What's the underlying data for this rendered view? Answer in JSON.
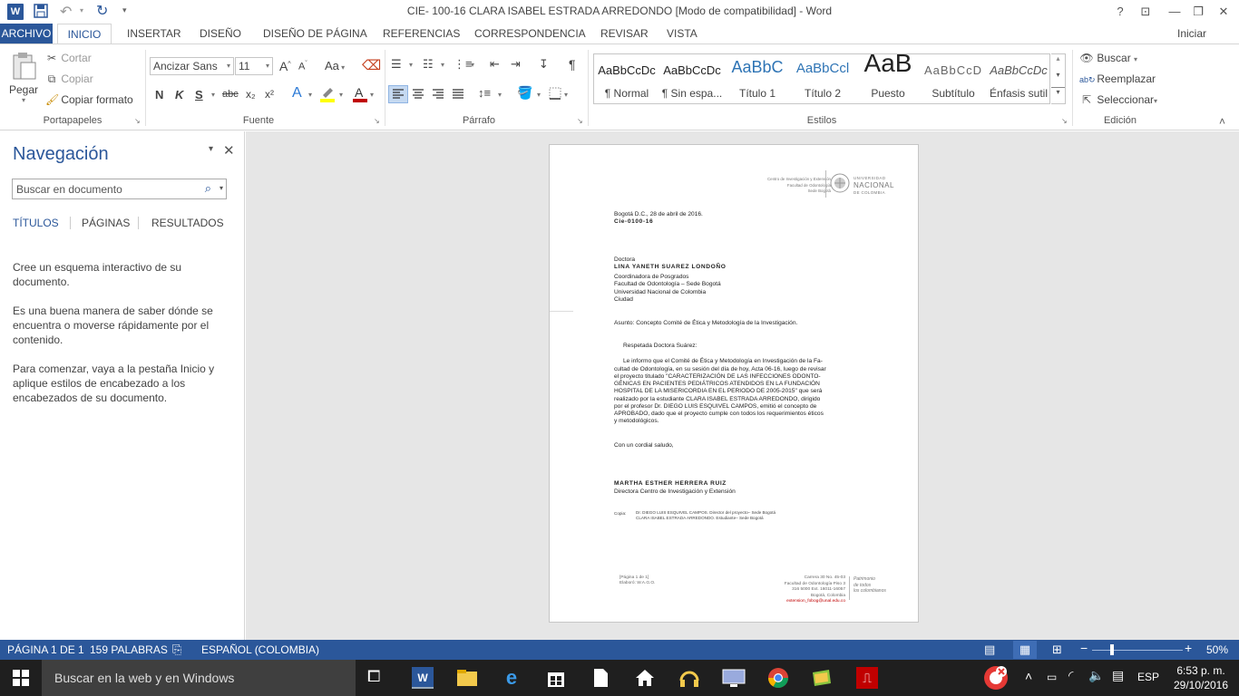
{
  "window": {
    "title": "CIE- 100-16 CLARA ISABEL ESTRADA ARREDONDO [Modo de compatibilidad] - Word",
    "app_icon": "W",
    "help": "?",
    "signin": "Iniciar sesión"
  },
  "tabs": [
    "ARCHIVO",
    "INICIO",
    "INSERTAR",
    "DISEÑO",
    "DISEÑO DE PÁGINA",
    "REFERENCIAS",
    "CORRESPONDENCIA",
    "REVISAR",
    "VISTA"
  ],
  "ribbon": {
    "clipboard": {
      "paste": "Pegar",
      "cut": "Cortar",
      "copy": "Copiar",
      "format_painter": "Copiar formato",
      "label": "Portapapeles"
    },
    "font": {
      "name": "Ancizar Sans",
      "size": "11",
      "label": "Fuente",
      "bold": "N",
      "italic": "K",
      "underline": "S",
      "strike": "abc",
      "sub": "x₂",
      "sup": "x²",
      "aa": "Aa",
      "grow": "A",
      "shrink": "A"
    },
    "paragraph": {
      "label": "Párrafo",
      "pilcrow": "¶"
    },
    "styles": {
      "label": "Estilos",
      "items": [
        {
          "preview": "AaBbCcDc",
          "name": "¶ Normal"
        },
        {
          "preview": "AaBbCcDc",
          "name": "¶ Sin espa..."
        },
        {
          "preview": "AaBbC",
          "name": "Título 1"
        },
        {
          "preview": "AaBbCcl",
          "name": "Título 2"
        },
        {
          "preview": "AaB",
          "name": "Puesto"
        },
        {
          "preview": "AaBbCcD",
          "name": "Subtítulo"
        },
        {
          "preview": "AaBbCcDc",
          "name": "Énfasis sutil"
        }
      ]
    },
    "editing": {
      "find": "Buscar",
      "replace": "Reemplazar",
      "select": "Seleccionar",
      "label": "Edición"
    }
  },
  "nav": {
    "title": "Navegación",
    "search_placeholder": "Buscar en documento",
    "tabs": [
      "TÍTULOS",
      "PÁGINAS",
      "RESULTADOS"
    ],
    "p1": "Cree un esquema interactivo de su documento.",
    "p2": "Es una buena manera de saber dónde se encuentra o moverse rápidamente por el contenido.",
    "p3": "Para comenzar, vaya a la pestaña Inicio y aplique estilos de encabezado a los encabezados de su documento."
  },
  "doc": {
    "header_left": [
      "Centro de Investigación y Extensión",
      "Facultad de Odontología",
      "Sede Bogotá"
    ],
    "header_right": [
      "UNIVERSIDAD",
      "NACIONAL",
      "DE COLOMBIA"
    ],
    "date": "Bogotá D.C., 28 de abril de 2016.",
    "ref": "Cie-0100-16",
    "salutation_title": "Doctora",
    "recipient": "LINA YANETH SUAREZ LONDOÑO",
    "recipient_lines": [
      "Coordinadora de Posgrados",
      "Facultad de Odontología – Sede Bogotá",
      "Universidad Nacional de Colombia",
      "Ciudad"
    ],
    "subject": "Asunto: Concepto Comité de Ética y Metodología de la Investigación.",
    "greeting": "Respetada Doctora Suárez:",
    "body": [
      "Le informo que el Comité de Ética y Metodología en Investigación de la Fa-",
      "cultad de Odontología, en su sesión del día de hoy, Acta 06-16, luego de revisar",
      "el proyecto titulado \"CARACTERIZACIÓN DE LAS INFECCIONES ODONTO-",
      "GÉNICAS EN PACIENTES PEDIÁTRICOS ATENDIDOS EN LA FUNDACIÓN",
      "HOSPITAL DE LA MISERICORDIA EN EL PERIODO DE 2005-2015\" que será",
      "realizado por la estudiante CLARA ISABEL ESTRADA ARREDONDO, dirigido",
      "por el profesor Dr. DIEGO LUIS ESQUIVEL CAMPOS, emitió el concepto de",
      "APROBADO, dado que el proyecto cumple con todos los requerimientos éticos",
      "y metodológicos."
    ],
    "closing": "Con un cordial saludo,",
    "signer": "MARTHA ESTHER HERRERA RUIZ",
    "signer_title": "Directora Centro de Investigación y Extensión",
    "copy_label": "Copia:",
    "copy1": "Dr. DIEGO LUIS ESQUIVEL CAMPOS. Director del proyecto– Sede Bogotá",
    "copy2": "CLARA ISABEL ESTRADA ARREDONDO. Estudiante– Sede Bogotá",
    "footer_left": [
      "[Página 1 de 1]",
      "Elaboró: W.A.G.O."
    ],
    "footer_mid": [
      "Carrera 30 No. 45-03",
      "Facultad de Odontología Piso 3",
      "316 5000 Ext. 16011-16057",
      "Bogotá, Colombia",
      "extension_fobog@unal.edu.co"
    ],
    "footer_right": [
      "Patrimonio",
      "de todos",
      "los colombianos"
    ]
  },
  "status": {
    "page": "PÁGINA 1 DE 1",
    "words": "159 PALABRAS",
    "lang": "ESPAÑOL (COLOMBIA)",
    "zoom": "50%",
    "zoom_level": 0.5
  },
  "taskbar": {
    "search": "Buscar en la web y en Windows",
    "lang": "ESP",
    "time": "6:53 p. m.",
    "date": "29/10/2016"
  },
  "colors": {
    "accent": "#2b579a"
  }
}
